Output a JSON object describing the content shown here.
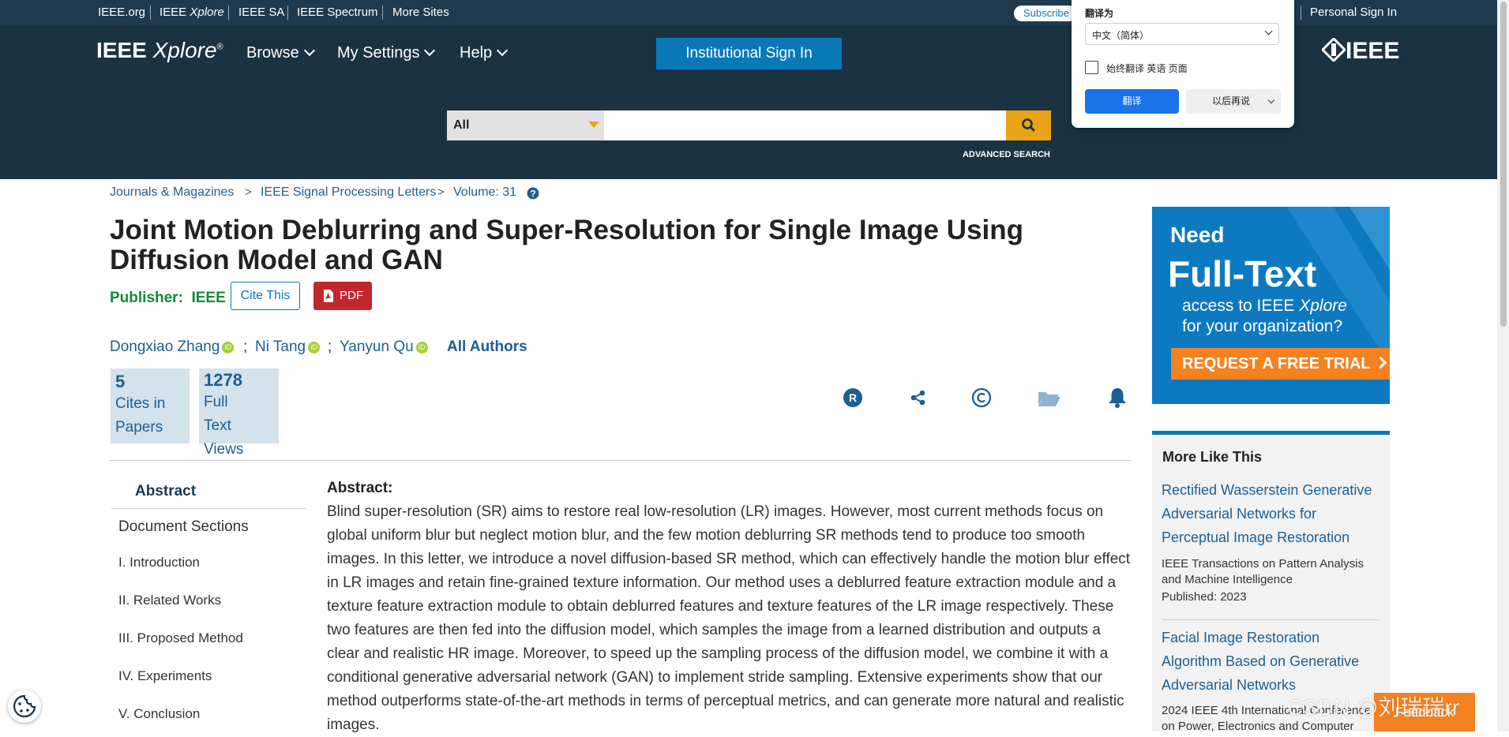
{
  "topbar": {
    "links": [
      "IEEE.org",
      "IEEE",
      "Xplore",
      "IEEE SA",
      "IEEE Spectrum",
      "More Sites"
    ],
    "subscribe": "Subscribe",
    "personal_sign_in": "Personal Sign In"
  },
  "header": {
    "logo_main": "IEEE",
    "logo_xplore": "Xplore",
    "logo_reg": "®",
    "nav": [
      "Browse",
      "My Settings",
      "Help"
    ],
    "institutional_sign_in": "Institutional Sign In",
    "ieee_logo": "IEEE",
    "search_scope": "All",
    "search_value": "",
    "advanced_search": "ADVANCED SEARCH"
  },
  "translate_popup": {
    "title": "翻译为",
    "language": "中文（简体）",
    "always_translate": "始终翻译 英语 页面",
    "always_checked": false,
    "translate_button": "翻译",
    "later_button": "以后再说"
  },
  "breadcrumb": [
    "Journals & Magazines",
    "IEEE Signal Processing Letters",
    "Volume: 31"
  ],
  "breadcrumb_sep": ">",
  "article": {
    "title": "Joint Motion Deblurring and Super-Resolution for Single Image Using Diffusion Model and GAN",
    "publisher_label": "Publisher:",
    "publisher": "IEEE",
    "cite_this": "Cite This",
    "pdf": "PDF",
    "authors": [
      "Dongxiao Zhang",
      "Ni Tang",
      "Yanyun Qu"
    ],
    "author_sep": ";",
    "orcid_mark": "iD",
    "all_authors": "All Authors",
    "metrics": [
      {
        "value": "5",
        "label_lines": [
          "Cites in",
          "Papers"
        ]
      },
      {
        "value": "1278",
        "label_lines": [
          "Full",
          "Text",
          "Views"
        ]
      }
    ]
  },
  "tool_icons": [
    "rights-icon",
    "share-icon",
    "copyright-icon",
    "folder-icon",
    "bell-icon"
  ],
  "sidebar": {
    "abstract": "Abstract",
    "document_sections": "Document Sections",
    "sections": [
      "I.  Introduction",
      "II.  Related Works",
      "III.  Proposed Method",
      "IV.  Experiments",
      "V.  Conclusion"
    ]
  },
  "abstract": {
    "heading": "Abstract:",
    "text": "Blind super-resolution (SR) aims to restore real low-resolution (LR) images. However, most current methods focus on global uniform blur but neglect motion blur, and the few motion deblurring SR methods tend to produce too smooth images. In this letter, we introduce a novel diffusion-based SR method, which can effectively handle the motion blur effect in LR images and retain fine-grained texture information. Our method uses a deblurred feature extraction module and a texture feature extraction module to obtain deblurred features and texture features of the LR image respectively. These two features are then fed into the diffusion model, which samples the image from a learned distribution and outputs a clear and realistic HR image. Moreover, to speed up the sampling process of the diffusion model, we combine it with a conditional generative adversarial network (GAN) to implement stride sampling. Extensive experiments show that our method outperforms state-of-the-art methods in terms of perceptual metrics, and can generate more natural and realistic images."
  },
  "ad": {
    "need": "Need",
    "full_text": "Full-Text",
    "line1": "access to IEEE",
    "line1_em": "Xplore",
    "line2": "for your organization?",
    "cta": "REQUEST A FREE TRIAL"
  },
  "more_like_this": {
    "heading": "More Like This",
    "items": [
      {
        "title": "Rectified Wasserstein Generative Adversarial Networks for Perceptual Image Restoration",
        "source": "IEEE Transactions on Pattern Analysis and Machine Intelligence",
        "published": "Published: 2023"
      },
      {
        "title": "Facial Image Restoration Algorithm Based on Generative Adversarial Networks",
        "source": "2024 IEEE 4th International Conference on Power, Electronics and Computer",
        "published": ""
      }
    ]
  },
  "feedback": "Feedback",
  "watermark": "CSDN @刘瑞瑞rr",
  "colors": {
    "header_bg": "#1b3243",
    "topbar_bg": "#1f3a4f",
    "accent_blue": "#0878b8",
    "search_orange": "#e8a317",
    "pdf_red": "#c1272d",
    "publisher_green": "#118a36",
    "cta_orange": "#f58220"
  }
}
